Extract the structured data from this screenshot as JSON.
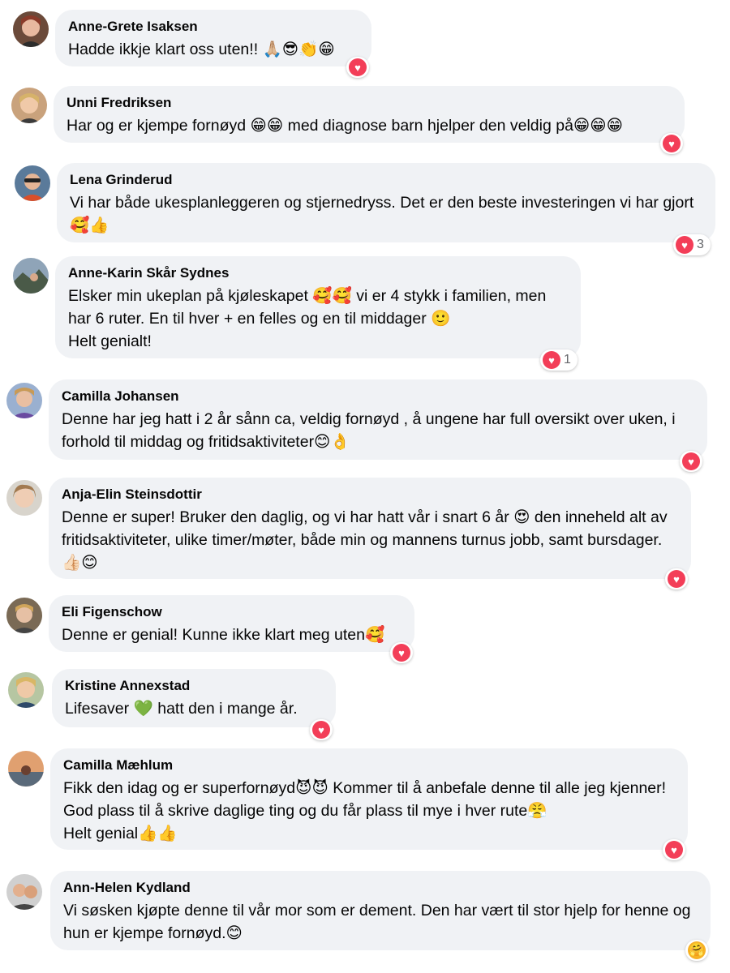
{
  "colors": {
    "bubble": "#f0f2f5",
    "heart": "#f33e58",
    "name": "#050505",
    "count": "#65676b"
  },
  "comments": [
    {
      "author": "Anne-Grete Isaksen",
      "text": "Hadde ikkje klart oss uten!! 🙏🏼😎👏😁",
      "reaction": "heart-icon",
      "count": ""
    },
    {
      "author": "Unni Fredriksen",
      "text": "Har og er kjempe fornøyd 😁😁 med diagnose barn hjelper den veldig på😁😁😁",
      "reaction": "heart-icon",
      "count": ""
    },
    {
      "author": "Lena Grinderud",
      "text": "Vi har både ukesplanleggeren og stjernedryss. Det er den beste investeringen vi har gjort 🥰👍",
      "reaction": "heart-icon",
      "count": "3"
    },
    {
      "author": "Anne-Karin Skår Sydnes",
      "text": "Elsker min ukeplan på kjøleskapet 🥰🥰 vi er 4 stykk i familien, men har 6 ruter. En til hver + en felles og en til middager 🙂\nHelt genialt!",
      "reaction": "heart-icon",
      "count": "1"
    },
    {
      "author": "Camilla Johansen",
      "text": "Denne har jeg hatt i 2 år sånn ca, veldig fornøyd , å ungene har full oversikt over uken, i forhold til middag og fritidsaktiviteter😊👌",
      "reaction": "heart-icon",
      "count": ""
    },
    {
      "author": "Anja-Elin Steinsdottir",
      "text": "Denne er super! Bruker den daglig, og vi har hatt vår i snart 6 år 😍 den inneheld alt av fritidsaktiviteter, ulike timer/møter, både min og mannens turnus jobb, samt bursdager. 👍🏻😊",
      "reaction": "heart-icon",
      "count": ""
    },
    {
      "author": "Eli Figenschow",
      "text": "Denne er genial! Kunne ikke klart meg uten🥰",
      "reaction": "heart-icon",
      "count": ""
    },
    {
      "author": "Kristine Annexstad",
      "text": "Lifesaver 💚 hatt den i mange år.",
      "reaction": "heart-icon",
      "count": ""
    },
    {
      "author": "Camilla Mæhlum",
      "text": "Fikk den idag og er superfornøyd😈😈 Kommer til å anbefale denne til alle jeg kjenner! God plass til å skrive daglige ting og du får plass til mye i hver rute😤\nHelt genial👍👍",
      "reaction": "heart-icon",
      "count": ""
    },
    {
      "author": "Ann-Helen Kydland",
      "text": "Vi søsken kjøpte denne til vår mor som er dement. Den har vært til stor hjelp for henne og hun er kjempe fornøyd.😊",
      "reaction": "care-icon",
      "count": ""
    }
  ]
}
